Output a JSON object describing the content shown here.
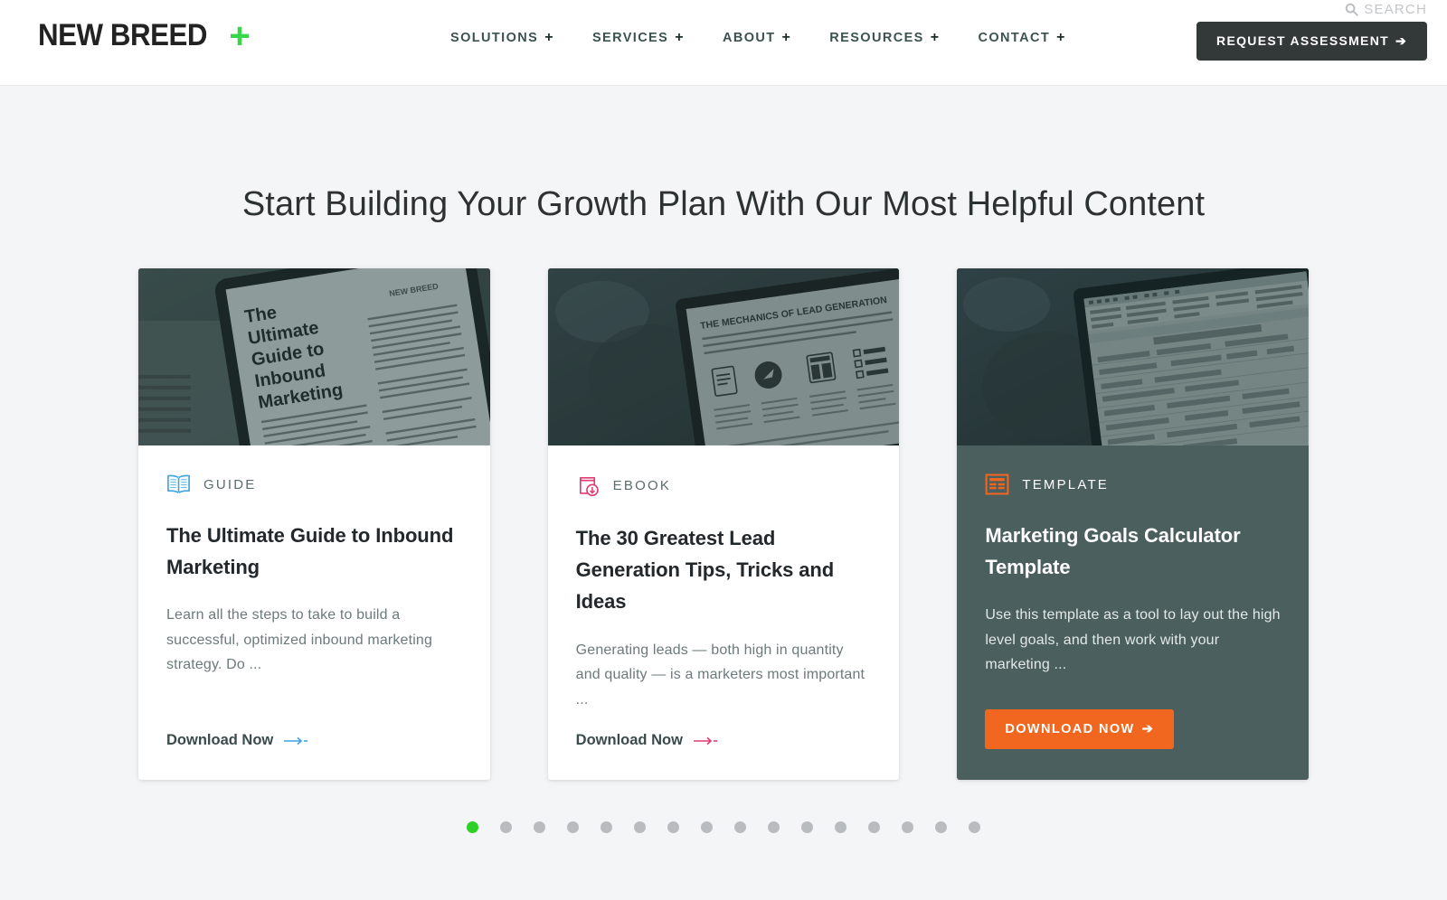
{
  "header": {
    "logo_text": "NEW BREED",
    "logo_plus": "+",
    "search_label": "SEARCH",
    "search_icon": "search-icon",
    "nav": [
      {
        "label": "SOLUTIONS",
        "plus": "+"
      },
      {
        "label": "SERVICES",
        "plus": "+"
      },
      {
        "label": "ABOUT",
        "plus": "+"
      },
      {
        "label": "RESOURCES",
        "plus": "+"
      },
      {
        "label": "CONTACT",
        "plus": "+"
      }
    ],
    "cta": {
      "label": "REQUEST ASSESSMENT",
      "arrow": "➔"
    }
  },
  "main": {
    "section_title": "Start Building Your Growth Plan With Our Most Helpful Content",
    "cards": [
      {
        "kicker": "GUIDE",
        "icon": "open-book-icon",
        "icon_color": "#3fa3de",
        "title": "The Ultimate Guide to Inbound Marketing",
        "description": "Learn all the steps to take to build a successful, optimized inbound marketing strategy. Do ...",
        "cta_label": "Download Now",
        "cta_arrow": "→",
        "cta_arrow_color": "#3fa3de",
        "cta_style": "link",
        "featured": false,
        "image_alt": "tablet showing The Ultimate Guide to Inbound Marketing ebook"
      },
      {
        "kicker": "EBOOK",
        "icon": "ebook-download-icon",
        "icon_color": "#e03b72",
        "title": "The 30 Greatest Lead Generation Tips, Tricks and Ideas",
        "description": "Generating leads — both high in quantity and quality — is a marketers most important ...",
        "cta_label": "Download Now",
        "cta_arrow": "→",
        "cta_arrow_color": "#e03b72",
        "cta_style": "link",
        "featured": false,
        "image_alt": "laptop showing The Mechanics of Lead Generation page"
      },
      {
        "kicker": "TEMPLATE",
        "icon": "template-document-icon",
        "icon_color": "#f2671f",
        "title": "Marketing Goals Calculator Template",
        "description": "Use this template as a tool to lay out the high level goals, and then work with your marketing ...",
        "cta_label": "DOWNLOAD NOW",
        "cta_arrow": "➔",
        "cta_arrow_color": "#ffffff",
        "cta_style": "button",
        "featured": true,
        "image_alt": "laptop showing a spreadsheet marketing goals calculator"
      }
    ],
    "pagination": {
      "active_index": 0,
      "count": 16
    }
  },
  "colors": {
    "page_background": "#f4f5f7",
    "featured_card_background": "#4a5f5e",
    "accent_orange": "#f2671f",
    "accent_green": "#3ad64a",
    "dot_active_green": "#2fd027",
    "header_cta_dark": "#333838"
  }
}
